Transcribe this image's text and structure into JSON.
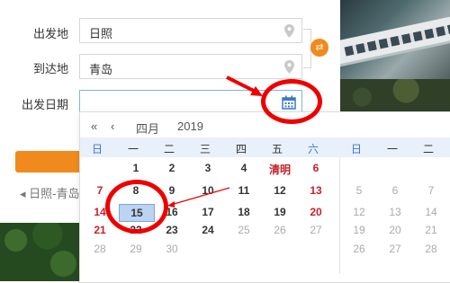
{
  "form": {
    "from_label": "出发地",
    "from_value": "日照",
    "to_label": "到达地",
    "to_value": "青岛",
    "date_label": "出发日期",
    "date_value": ""
  },
  "route_text": "◂ 日照-青岛",
  "calendar": {
    "prev_year": "«",
    "prev_month": "‹",
    "month": "四月",
    "year": "2019",
    "weekdays_left": [
      "日",
      "一",
      "二",
      "三",
      "四",
      "五",
      "六"
    ],
    "weekdays_right": [
      "日",
      "一",
      "二"
    ],
    "rows_left": [
      [
        "",
        "1",
        "2",
        "3",
        "4",
        "清明",
        "6"
      ],
      [
        "7",
        "8",
        "9",
        "10",
        "11",
        "12",
        "13"
      ],
      [
        "14",
        "15",
        "16",
        "17",
        "18",
        "19",
        "20"
      ],
      [
        "21",
        "22",
        "23",
        "24",
        "25",
        "26",
        "27"
      ],
      [
        "28",
        "29",
        "30",
        "",
        "",
        "",
        ""
      ]
    ],
    "rows_right": [
      [
        "",
        "",
        ""
      ],
      [
        "5",
        "6",
        "7"
      ],
      [
        "12",
        "13",
        "14"
      ],
      [
        "19",
        "20",
        "21"
      ],
      [
        "26",
        "27",
        "28"
      ]
    ],
    "selected": "15"
  },
  "colors": {
    "accent": "#f08a1d",
    "highlight": "#e00000",
    "weekend": "#c8202a"
  }
}
